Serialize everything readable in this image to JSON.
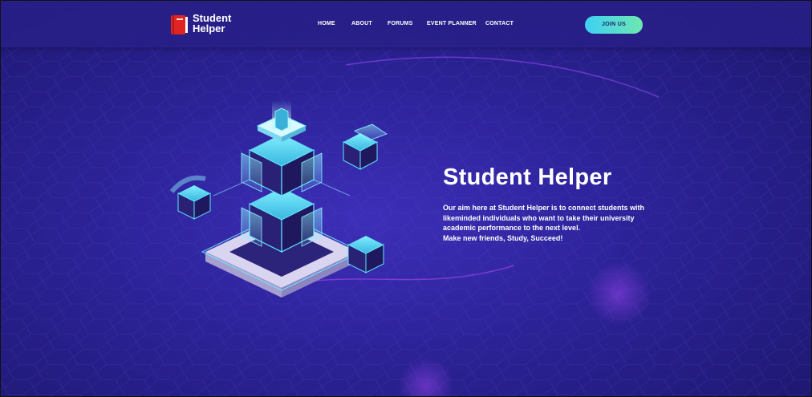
{
  "brand": {
    "name_line1": "Student",
    "name_line2": "Helper",
    "logo_icon": "book-icon"
  },
  "nav": {
    "items": [
      {
        "label": "HOME"
      },
      {
        "label": "ABOUT"
      },
      {
        "label": "FORUMS"
      },
      {
        "label": "EVENT PLANNER"
      },
      {
        "label": "CONTACT"
      }
    ],
    "cta_label": "JOIN US"
  },
  "hero": {
    "title": "Student Helper",
    "description": "Our aim here at Student Helper is to connect students with likeminded individuals who want to take their university academic performance to the next level.",
    "tagline": "Make new friends, Study, Succeed!"
  },
  "colors": {
    "background": "#2d239a",
    "navbar": "#28208a",
    "accent_gradient_start": "#3fd0f4",
    "accent_gradient_end": "#6ee7b0",
    "logo_red": "#e02424"
  }
}
